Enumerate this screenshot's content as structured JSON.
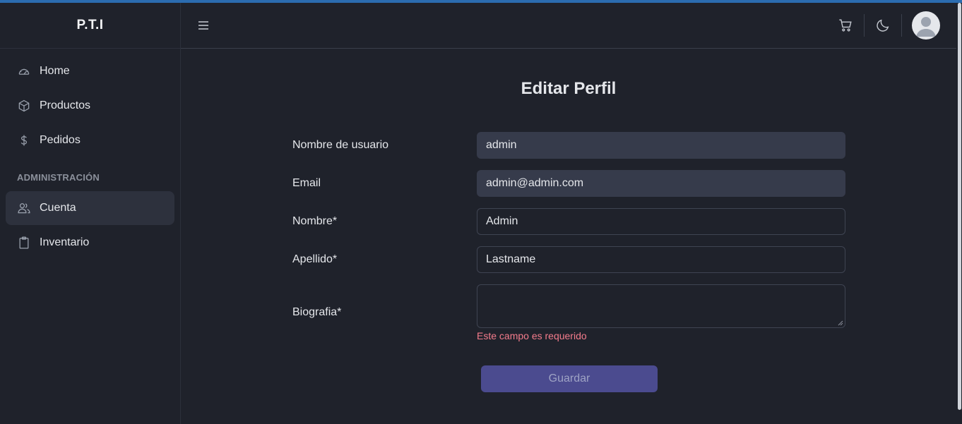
{
  "app": {
    "brand": "P.T.I"
  },
  "sidebar": {
    "items": [
      {
        "label": "Home",
        "icon": "gauge-icon"
      },
      {
        "label": "Productos",
        "icon": "cube-icon"
      },
      {
        "label": "Pedidos",
        "icon": "dollar-icon"
      }
    ],
    "section_title": "ADMINISTRACIÓN",
    "admin_items": [
      {
        "label": "Cuenta",
        "icon": "users-icon",
        "active": true
      },
      {
        "label": "Inventario",
        "icon": "clipboard-icon"
      }
    ]
  },
  "header": {
    "menu_icon": "hamburger-icon",
    "cart_icon": "cart-icon",
    "theme_icon": "moon-icon",
    "avatar_icon": "user-avatar-icon"
  },
  "main": {
    "title": "Editar Perfil",
    "fields": {
      "username": {
        "label": "Nombre de usuario",
        "value": "admin"
      },
      "email": {
        "label": "Email",
        "value": "admin@admin.com"
      },
      "first_name": {
        "label": "Nombre*",
        "value": "Admin"
      },
      "last_name": {
        "label": "Apellido*",
        "value": "Lastname"
      },
      "bio": {
        "label": "Biografia*",
        "value": "",
        "error": "Este campo es requerido"
      }
    },
    "save_label": "Guardar"
  },
  "colors": {
    "background": "#1f222b",
    "active_nav": "#2d313d",
    "input_filled": "#363b4b",
    "button": "#4b4b8f",
    "error": "#f47c8c",
    "topline": "#2b6cb0"
  }
}
